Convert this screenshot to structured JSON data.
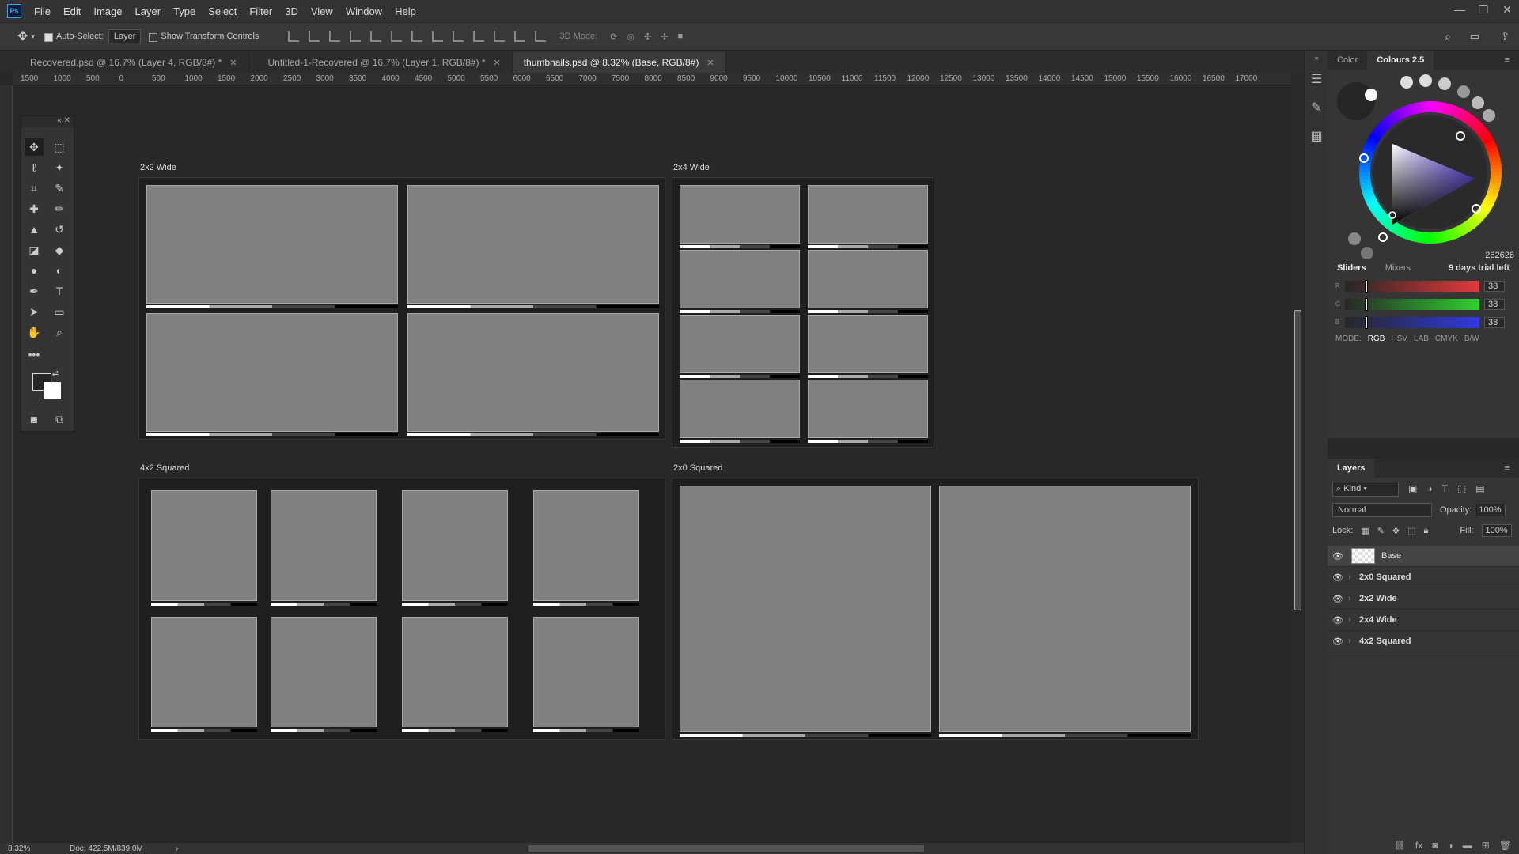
{
  "app": {
    "icon": "Ps"
  },
  "menu": [
    "File",
    "Edit",
    "Image",
    "Layer",
    "Type",
    "Select",
    "Filter",
    "3D",
    "View",
    "Window",
    "Help"
  ],
  "window_controls": {
    "minimize": "—",
    "restore": "❐",
    "close": "✕"
  },
  "options_bar": {
    "auto_select_label": "Auto-Select:",
    "auto_select_value": "Layer",
    "show_transform_label": "Show Transform Controls",
    "mode_3d_label": "3D Mode:"
  },
  "tabs": [
    {
      "label": "Recovered.psd @ 16.7% (Layer 4, RGB/8#) *",
      "close": "✕"
    },
    {
      "label": "Untitled-1-Recovered @ 16.7% (Layer 1, RGB/8#) *",
      "close": "✕"
    },
    {
      "label": "thumbnails.psd @ 8.32% (Base, RGB/8#)",
      "close": "✕"
    }
  ],
  "ruler_h": [
    "1500",
    "1000",
    "500",
    "0",
    "500",
    "1000",
    "1500",
    "2000",
    "2500",
    "3000",
    "3500",
    "4000",
    "4500",
    "5000",
    "5500",
    "6000",
    "6500",
    "7000",
    "7500",
    "8000",
    "8500",
    "9000",
    "9500",
    "10000",
    "10500",
    "11000",
    "11500",
    "12000",
    "12500",
    "13000",
    "13500",
    "14000",
    "14500",
    "15000",
    "15500",
    "16000",
    "16500",
    "17000"
  ],
  "artboards": {
    "a1": "2x2 Wide",
    "a2": "2x4 Wide",
    "a3": "4x2 Squared",
    "a4": "2x0 Squared"
  },
  "color_panel": {
    "tabs": [
      "Color",
      "Colours 2.5"
    ],
    "hex": "262626",
    "sub_tabs": [
      "Sliders",
      "Mixers"
    ],
    "trial": "9 days trial left",
    "channels": [
      {
        "name": "R",
        "value": "38",
        "color": "#e23a3a"
      },
      {
        "name": "G",
        "value": "38",
        "color": "#2fd12f"
      },
      {
        "name": "B",
        "value": "38",
        "color": "#2f3ae0"
      }
    ],
    "mode_label": "MODE:",
    "modes": [
      "RGB",
      "HSV",
      "LAB",
      "CMYK",
      "B/W"
    ]
  },
  "layers_panel": {
    "title": "Layers",
    "kind": "Kind",
    "blend_mode": "Normal",
    "opacity_label": "Opacity:",
    "opacity": "100%",
    "lock_label": "Lock:",
    "fill_label": "Fill:",
    "fill": "100%",
    "layers": [
      "Base",
      "2x0 Squared",
      "2x2 Wide",
      "2x4 Wide",
      "4x2 Squared"
    ]
  },
  "status": {
    "zoom": "8.32%",
    "doc": "Doc: 422.5M/839.0M"
  }
}
